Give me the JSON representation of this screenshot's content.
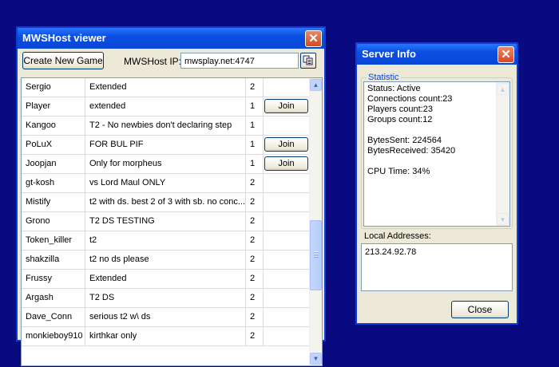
{
  "viewer": {
    "title": "MWSHost viewer",
    "create_game_label": "Create New Game",
    "host_ip_label": "MWSHost IP:",
    "host_ip_value": "mwsplay.net:4747",
    "games": [
      {
        "host": "Sergio",
        "name": "Extended",
        "players": "2",
        "join": ""
      },
      {
        "host": "Player",
        "name": "extended",
        "players": "1",
        "join": "Join"
      },
      {
        "host": "Kangoo",
        "name": "T2 - No newbies don't declaring step",
        "players": "1",
        "join": ""
      },
      {
        "host": "PoLuX",
        "name": "FOR BUL PIF",
        "players": "1",
        "join": "Join"
      },
      {
        "host": "Joopjan",
        "name": "Only for morpheus",
        "players": "1",
        "join": "Join"
      },
      {
        "host": "gt-kosh",
        "name": "vs Lord Maul ONLY",
        "players": "2",
        "join": ""
      },
      {
        "host": "Mistify",
        "name": "t2 with ds. best 2 of 3 with sb. no conc...",
        "players": "2",
        "join": ""
      },
      {
        "host": "Grono",
        "name": "T2 DS TESTING",
        "players": "2",
        "join": ""
      },
      {
        "host": "Token_killer",
        "name": "t2",
        "players": "2",
        "join": ""
      },
      {
        "host": "shakzilla",
        "name": "t2 no ds please",
        "players": "2",
        "join": ""
      },
      {
        "host": "Frussy",
        "name": "Extended",
        "players": "2",
        "join": ""
      },
      {
        "host": "Argash",
        "name": "T2 DS",
        "players": "2",
        "join": ""
      },
      {
        "host": "Dave_Conn",
        "name": "serious t2 w\\ ds",
        "players": "2",
        "join": ""
      },
      {
        "host": "monkieboy910",
        "name": "kirthkar only",
        "players": "2",
        "join": ""
      }
    ]
  },
  "server": {
    "title": "Server Info",
    "statistic_label": "Statistic",
    "stats": [
      "Status: Active",
      "Connections count:23",
      "Players count:23",
      "Groups count:12",
      "",
      "BytesSent: 224564",
      "BytesReceived: 35420",
      "",
      "CPU Time: 34%"
    ],
    "local_addresses_label": "Local Addresses:",
    "local_address": "213.24.92.78",
    "close_label": "Close"
  },
  "icons": {
    "close": "close-icon",
    "browse": "copy-icon",
    "scroll_up": "chevron-up-icon",
    "scroll_down": "chevron-down-icon"
  }
}
